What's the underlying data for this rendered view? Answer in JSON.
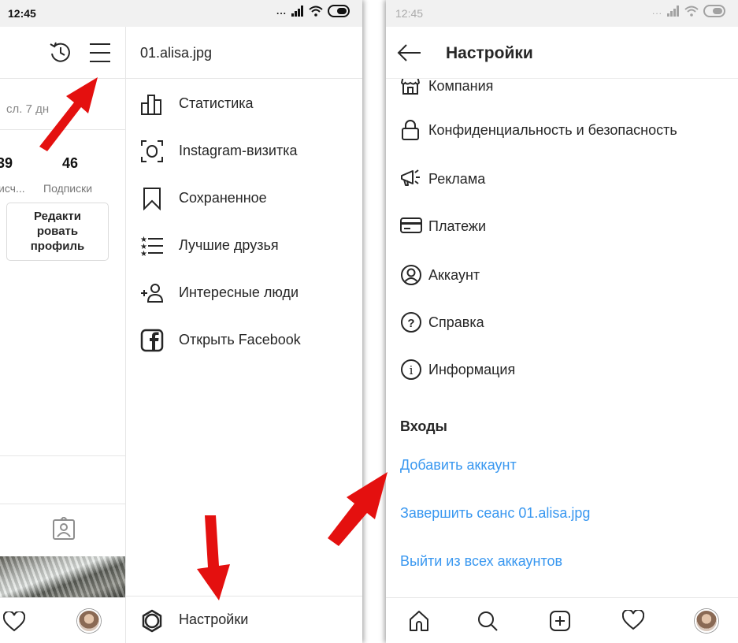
{
  "status": {
    "time": "12:45",
    "signal": "...",
    "right_time": "12:45"
  },
  "profile": {
    "hint": "сл. 7 дн",
    "stats": [
      {
        "value": "39",
        "label": "исч..."
      },
      {
        "value": "46",
        "label": "Подписки"
      }
    ],
    "edit_lines": [
      "Редакти",
      "ровать",
      "профиль"
    ]
  },
  "drawer": {
    "username": "01.alisa.jpg",
    "items": [
      {
        "label": "Статистика",
        "icon": "bar-chart-icon"
      },
      {
        "label": "Instagram-визитка",
        "icon": "scan-icon"
      },
      {
        "label": "Сохраненное",
        "icon": "bookmark-icon"
      },
      {
        "label": "Лучшие друзья",
        "icon": "close-friends-icon"
      },
      {
        "label": "Интересные люди",
        "icon": "add-person-icon"
      },
      {
        "label": "Открыть Facebook",
        "icon": "facebook-icon"
      }
    ],
    "settings_label": "Настройки"
  },
  "settings": {
    "title": "Настройки",
    "items": [
      {
        "label": "Компания",
        "icon": "shop-icon"
      },
      {
        "label": "Конфиденциальность и безопасность",
        "icon": "lock-icon"
      },
      {
        "label": "Реклама",
        "icon": "megaphone-icon"
      },
      {
        "label": "Платежи",
        "icon": "card-icon"
      },
      {
        "label": "Аккаунт",
        "icon": "account-icon"
      },
      {
        "label": "Справка",
        "icon": "help-icon"
      },
      {
        "label": "Информация",
        "icon": "info-icon"
      }
    ],
    "logins_title": "Входы",
    "links": [
      "Добавить аккаунт",
      "Завершить сеанс 01.alisa.jpg",
      "Выйти из всех аккаунтов"
    ]
  },
  "colors": {
    "link": "#3897f0",
    "arrow": "#e4100f",
    "text": "#262626"
  }
}
